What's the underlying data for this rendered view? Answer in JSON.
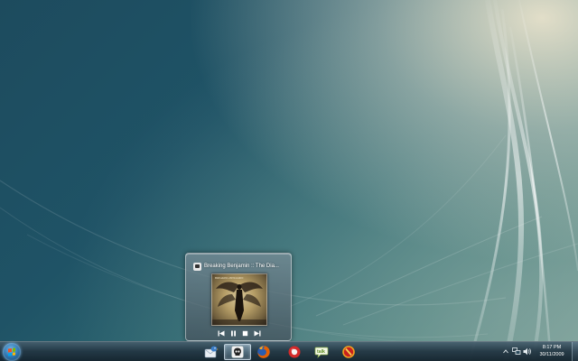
{
  "preview": {
    "title": "Breaking Benjamin :: The Dia...",
    "app_icon": "winamp-skull-icon",
    "controls": [
      "previous-track-icon",
      "pause-icon",
      "stop-icon",
      "next-track-icon"
    ]
  },
  "taskbar": {
    "start_icon": "windows-orb-icon",
    "pinned": [
      {
        "name": "taskbar-mail-app",
        "icon": "mail-bird-icon"
      },
      {
        "name": "taskbar-media-player",
        "icon": "winamp-skull-icon",
        "active": true
      },
      {
        "name": "taskbar-firefox",
        "icon": "firefox-icon"
      },
      {
        "name": "taskbar-red-app",
        "icon": "red-circle-icon"
      },
      {
        "name": "taskbar-talk",
        "icon": "talk-bubble-icon"
      },
      {
        "name": "taskbar-red-orange-app",
        "icon": "no-entry-circle-icon"
      }
    ]
  },
  "tray": {
    "icons": [
      "show-hidden-icons-arrow",
      "network-icon",
      "volume-icon"
    ],
    "clock_time": "8:17 PM",
    "clock_date": "30/11/2009"
  },
  "colors": {
    "accent": "#2a6fa8",
    "firefox_orange": "#e66000",
    "red_app": "#d42a2a"
  }
}
